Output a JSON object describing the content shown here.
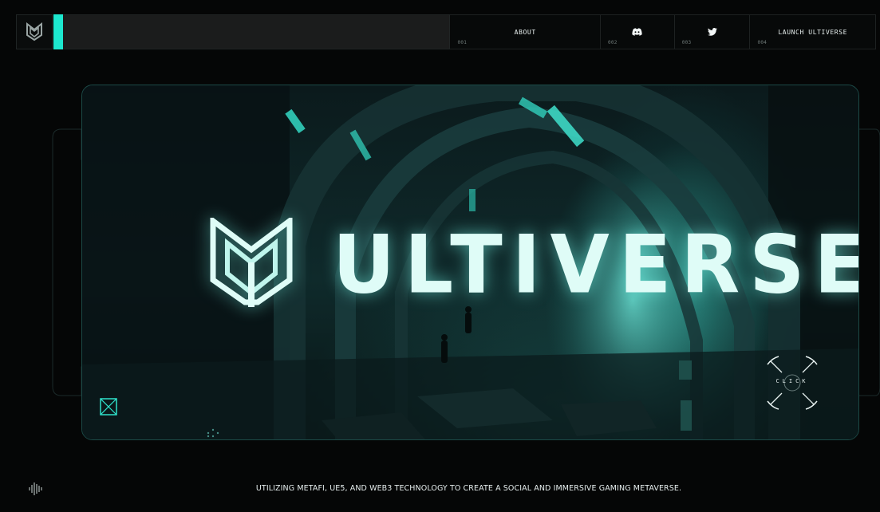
{
  "nav": {
    "items": [
      {
        "label": "ABOUT",
        "num": "001"
      },
      {
        "label": "",
        "num": "002",
        "icon": "discord-icon"
      },
      {
        "label": "",
        "num": "003",
        "icon": "twitter-icon"
      },
      {
        "label": "LAUNCH ULTIVERSE",
        "num": "004"
      }
    ]
  },
  "hero": {
    "brand_word": "ULTIVERSE",
    "click_label": "CLICK"
  },
  "footer": {
    "tagline": "UTILIZING METAFI, UE5, AND WEB3 TECHNOLOGY  TO CREATE A SOCIAL AND IMMERSIVE GAMING METAVERSE."
  },
  "colors": {
    "accent": "#1de8cf",
    "background": "#050606",
    "frame": "#1c4a47"
  }
}
